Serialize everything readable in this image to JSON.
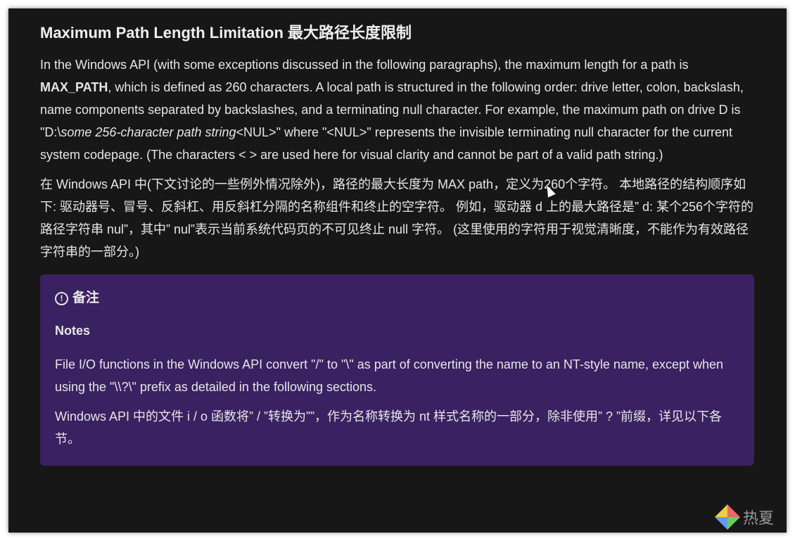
{
  "title": "Maximum Path Length Limitation 最大路径长度限制",
  "para1": {
    "a": "In the Windows API (with some exceptions discussed in the following paragraphs), the maximum length for a path is ",
    "b": "MAX_PATH",
    "c": ", which is defined as 260 characters. A local path is structured in the following order: drive letter, colon, backslash, name components separated by backslashes, and a terminating null character. For example, the maximum path on drive D is \"D:\\",
    "d": "some 256-character path string",
    "e": "<NUL>\" where \"<NUL>\" represents the invisible terminating null character for the current system codepage. (The characters < > are used here for visual clarity and cannot be part of a valid path string.)"
  },
  "para2": "在 Windows API 中(下文讨论的一些例外情况除外)，路径的最大长度为 MAX path，定义为260个字符。 本地路径的结构顺序如下: 驱动器号、冒号、反斜杠、用反斜杠分隔的名称组件和终止的空字符。 例如，驱动器 d 上的最大路径是” d: 某个256个字符的路径字符串 nul”，其中” nul”表示当前系统代码页的不可见终止 null 字符。 (这里使用的字符用于视觉清晰度，不能作为有效路径字符串的一部分。)",
  "note": {
    "heading": "备注",
    "icon": "!",
    "label": "Notes",
    "text1": "File I/O functions in the Windows API convert \"/\" to \"\\\" as part of converting the name to an NT-style name, except when using the \"\\\\?\\\" prefix as detailed in the following sections.",
    "text2": "Windows API 中的文件 i / o 函数将” / ”转换为””，作为名称转换为 nt 样式名称的一部分，除非使用” ? ”前缀，详见以下各节。"
  },
  "watermark": "热夏"
}
